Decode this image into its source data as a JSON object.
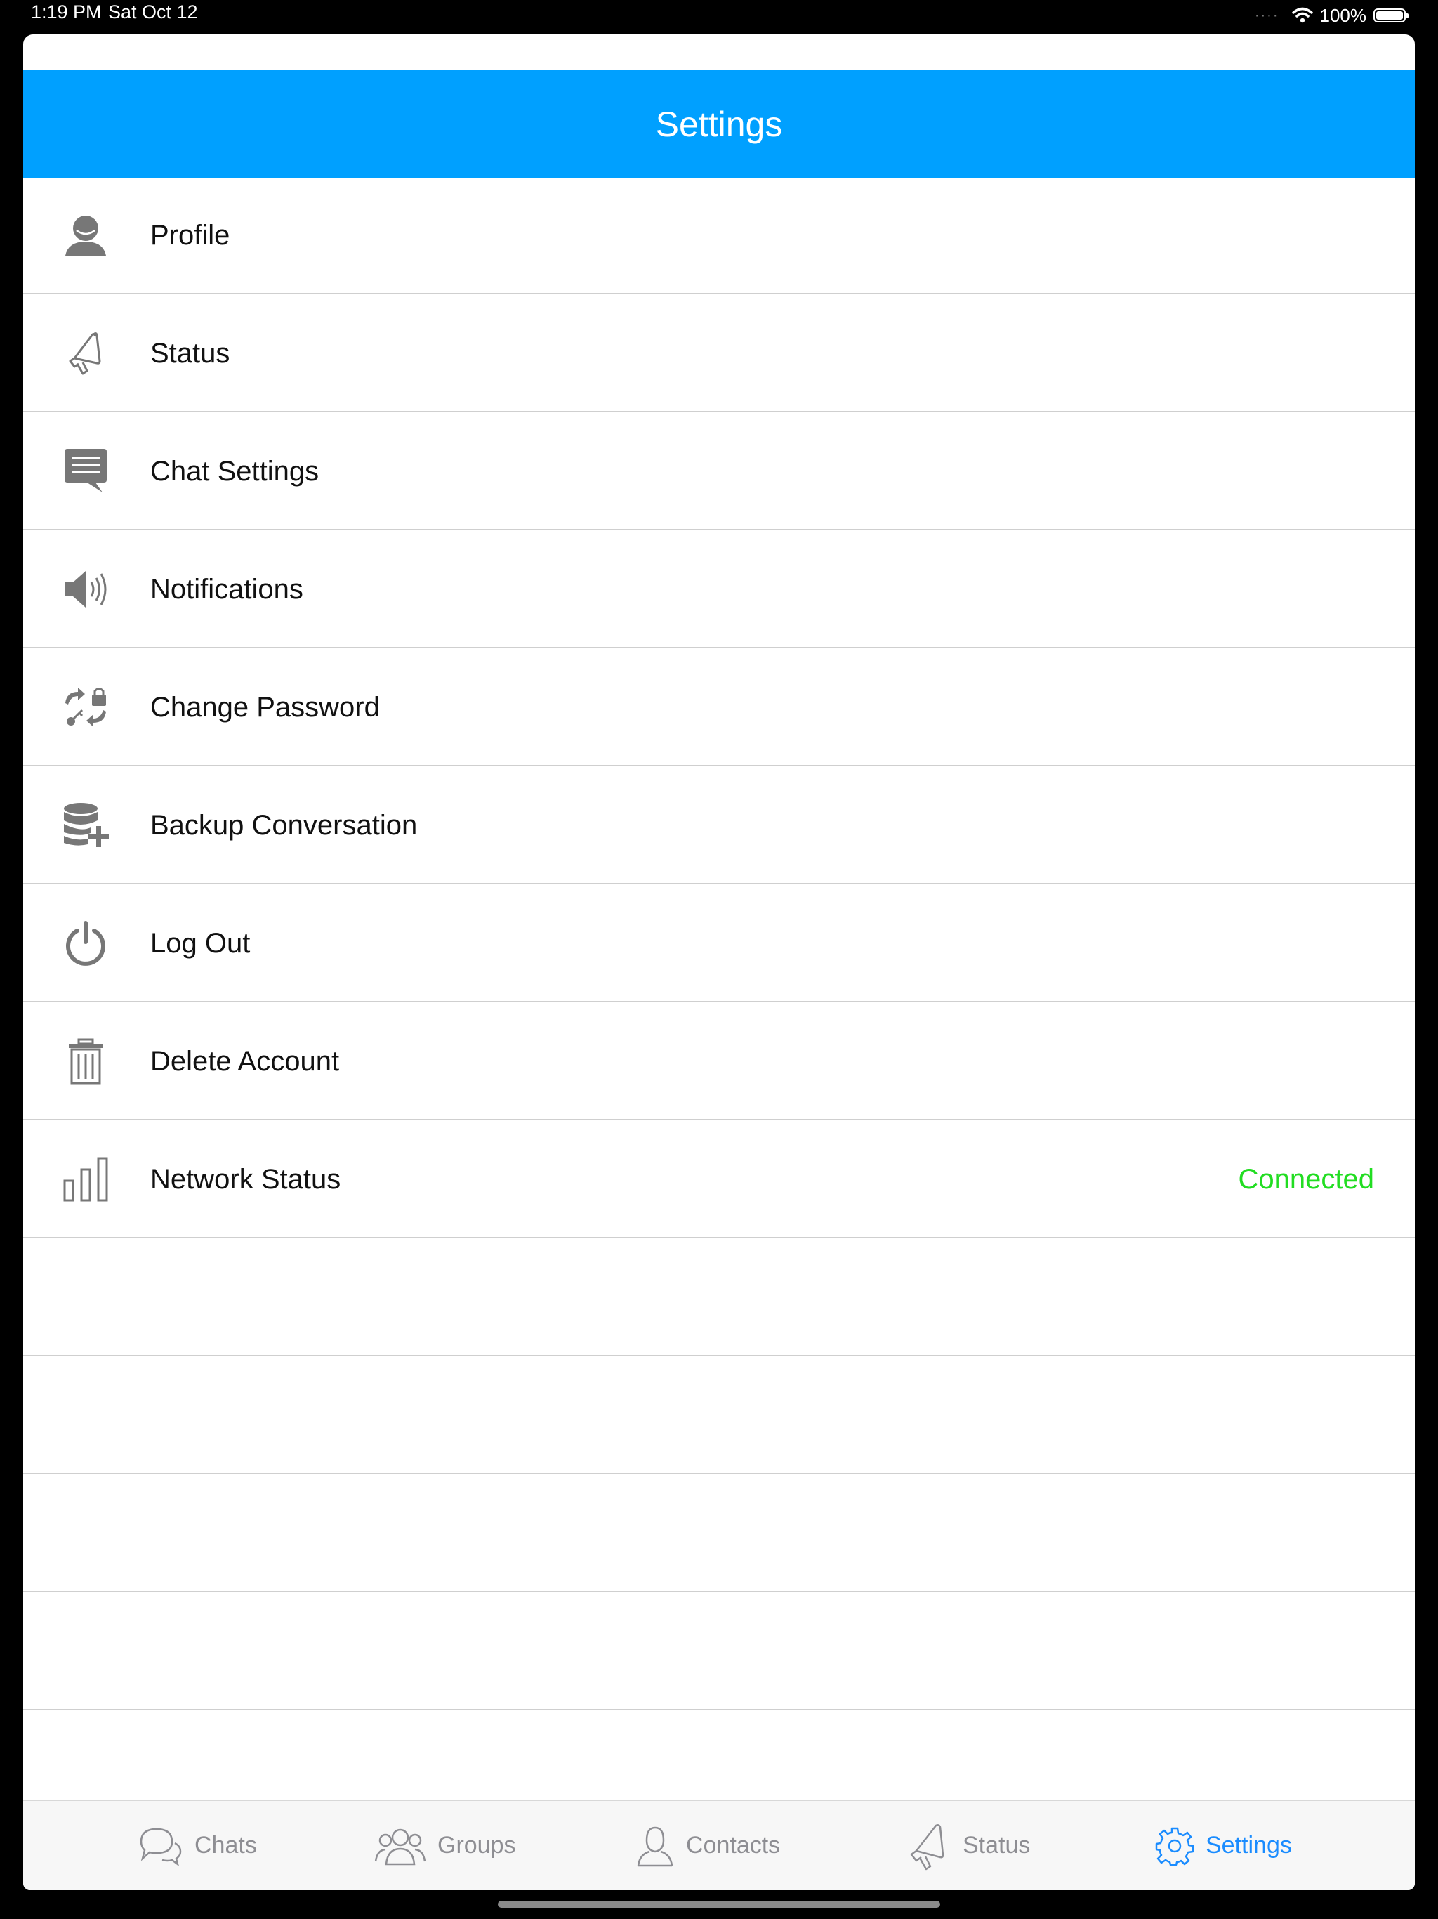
{
  "status_bar": {
    "time": "1:19 PM",
    "date": "Sat Oct 12",
    "battery": "100%"
  },
  "header": {
    "title": "Settings"
  },
  "settings": {
    "items": [
      {
        "label": "Profile",
        "icon": "profile-icon"
      },
      {
        "label": "Status",
        "icon": "megaphone-icon"
      },
      {
        "label": "Chat Settings",
        "icon": "chat-bubble-icon"
      },
      {
        "label": "Notifications",
        "icon": "speaker-icon"
      },
      {
        "label": "Change Password",
        "icon": "password-change-icon"
      },
      {
        "label": "Backup Conversation",
        "icon": "database-add-icon"
      },
      {
        "label": "Log Out",
        "icon": "power-icon"
      },
      {
        "label": "Delete Account",
        "icon": "trash-icon"
      },
      {
        "label": "Network Status",
        "icon": "signal-bars-icon",
        "value": "Connected",
        "value_color": "#22dd22"
      }
    ]
  },
  "tabbar": {
    "tabs": [
      {
        "label": "Chats",
        "icon": "chats-icon"
      },
      {
        "label": "Groups",
        "icon": "groups-icon"
      },
      {
        "label": "Contacts",
        "icon": "contact-icon"
      },
      {
        "label": "Status",
        "icon": "megaphone-icon"
      },
      {
        "label": "Settings",
        "icon": "gear-icon",
        "active": true
      }
    ]
  },
  "colors": {
    "accent": "#00a0ff",
    "tab_active": "#1a8cff",
    "connected": "#22dd22"
  }
}
